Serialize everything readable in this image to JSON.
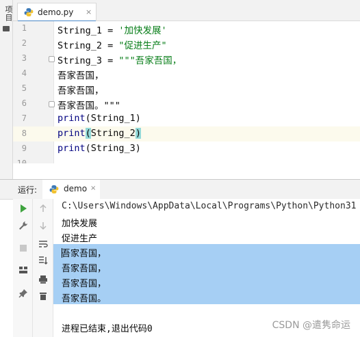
{
  "project_strip": {
    "label": "项目"
  },
  "editor_tab": {
    "label": "demo.py",
    "close": "×"
  },
  "editor": {
    "lines": [
      {
        "num": "1",
        "text": "String_1 = '加快发展'"
      },
      {
        "num": "2",
        "text": "String_2 = \"促进生产\""
      },
      {
        "num": "3",
        "text": "String_3 = \"\"\"吾家吾国，"
      },
      {
        "num": "4",
        "text": "吾家吾国，"
      },
      {
        "num": "5",
        "text": "吾家吾国，"
      },
      {
        "num": "6",
        "text": "吾家吾国。\"\"\""
      },
      {
        "num": "7",
        "text": "print(String_1)"
      },
      {
        "num": "8",
        "text": "print(String_2)"
      },
      {
        "num": "9",
        "text": "print(String_3)"
      },
      {
        "num": "10",
        "text": ""
      }
    ]
  },
  "run_panel": {
    "title": "运行:",
    "tab_label": "demo",
    "tab_close": "×",
    "console_lines": [
      "C:\\Users\\Windows\\AppData\\Local\\Programs\\Python\\Python31",
      "加快发展",
      "促进生产",
      "吾家吾国，",
      "吾家吾国，",
      "吾家吾国，",
      "吾家吾国。",
      "",
      "进程已结束,退出代码0"
    ]
  },
  "watermark": "CSDN @遣隽命运",
  "colors": {
    "accent": "#4a88c7",
    "keyword": "#000080",
    "string": "#067d17",
    "selection": "#a6cff4",
    "run_green": "#3fa33f"
  }
}
